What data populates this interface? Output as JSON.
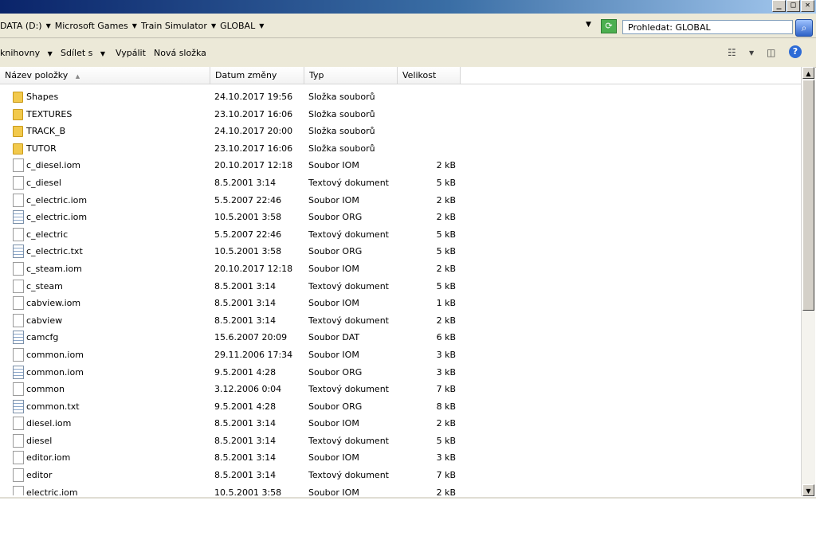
{
  "window": {
    "controls": {
      "minimize": "_",
      "maximize": "□",
      "close": "✕"
    }
  },
  "address": {
    "crumbs": [
      "DATA (D:)",
      "Microsoft Games",
      "Train Simulator",
      "GLOBAL"
    ],
    "search_placeholder": "Prohledat: GLOBAL"
  },
  "toolbar": {
    "library": "knihovny",
    "share": "Sdílet s",
    "burn": "Vypálit",
    "new_folder": "Nová složka"
  },
  "columns": {
    "name": "Název položky",
    "date": "Datum změny",
    "type": "Typ",
    "size": "Velikost"
  },
  "files": [
    {
      "icon": "folder",
      "name": "Shapes",
      "date": "24.10.2017 19:56",
      "type": "Složka souborů",
      "size": ""
    },
    {
      "icon": "folder",
      "name": "TEXTURES",
      "date": "23.10.2017 16:06",
      "type": "Složka souborů",
      "size": ""
    },
    {
      "icon": "folder",
      "name": "TRACK_B",
      "date": "24.10.2017 20:00",
      "type": "Složka souborů",
      "size": ""
    },
    {
      "icon": "folder",
      "name": "TUTOR",
      "date": "23.10.2017 16:06",
      "type": "Složka souborů",
      "size": ""
    },
    {
      "icon": "file",
      "name": "c_diesel.iom",
      "date": "20.10.2017 12:18",
      "type": "Soubor IOM",
      "size": "2 kB"
    },
    {
      "icon": "file",
      "name": "c_diesel",
      "date": "8.5.2001 3:14",
      "type": "Textový dokument",
      "size": "5 kB"
    },
    {
      "icon": "file",
      "name": "c_electric.iom",
      "date": "5.5.2007 22:46",
      "type": "Soubor IOM",
      "size": "2 kB"
    },
    {
      "icon": "lines",
      "name": "c_electric.iom",
      "date": "10.5.2001 3:58",
      "type": "Soubor ORG",
      "size": "2 kB"
    },
    {
      "icon": "file",
      "name": "c_electric",
      "date": "5.5.2007 22:46",
      "type": "Textový dokument",
      "size": "5 kB"
    },
    {
      "icon": "lines",
      "name": "c_electric.txt",
      "date": "10.5.2001 3:58",
      "type": "Soubor ORG",
      "size": "5 kB"
    },
    {
      "icon": "file",
      "name": "c_steam.iom",
      "date": "20.10.2017 12:18",
      "type": "Soubor IOM",
      "size": "2 kB"
    },
    {
      "icon": "file",
      "name": "c_steam",
      "date": "8.5.2001 3:14",
      "type": "Textový dokument",
      "size": "5 kB"
    },
    {
      "icon": "file",
      "name": "cabview.iom",
      "date": "8.5.2001 3:14",
      "type": "Soubor IOM",
      "size": "1 kB"
    },
    {
      "icon": "file",
      "name": "cabview",
      "date": "8.5.2001 3:14",
      "type": "Textový dokument",
      "size": "2 kB"
    },
    {
      "icon": "lines",
      "name": "camcfg",
      "date": "15.6.2007 20:09",
      "type": "Soubor DAT",
      "size": "6 kB"
    },
    {
      "icon": "file",
      "name": "common.iom",
      "date": "29.11.2006 17:34",
      "type": "Soubor IOM",
      "size": "3 kB"
    },
    {
      "icon": "lines",
      "name": "common.iom",
      "date": "9.5.2001 4:28",
      "type": "Soubor ORG",
      "size": "3 kB"
    },
    {
      "icon": "file",
      "name": "common",
      "date": "3.12.2006 0:04",
      "type": "Textový dokument",
      "size": "7 kB"
    },
    {
      "icon": "lines",
      "name": "common.txt",
      "date": "9.5.2001 4:28",
      "type": "Soubor ORG",
      "size": "8 kB"
    },
    {
      "icon": "file",
      "name": "diesel.iom",
      "date": "8.5.2001 3:14",
      "type": "Soubor IOM",
      "size": "2 kB"
    },
    {
      "icon": "file",
      "name": "diesel",
      "date": "8.5.2001 3:14",
      "type": "Textový dokument",
      "size": "5 kB"
    },
    {
      "icon": "file",
      "name": "editor.iom",
      "date": "8.5.2001 3:14",
      "type": "Soubor IOM",
      "size": "3 kB"
    },
    {
      "icon": "file",
      "name": "editor",
      "date": "8.5.2001 3:14",
      "type": "Textový dokument",
      "size": "7 kB"
    },
    {
      "icon": "file",
      "name": "electric.iom",
      "date": "10.5.2001 3:58",
      "type": "Soubor IOM",
      "size": "2 kB"
    }
  ]
}
